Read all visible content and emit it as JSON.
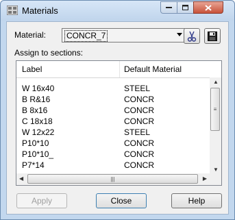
{
  "window": {
    "title": "Materials",
    "controls": {
      "minimize": "–",
      "maximize": "□",
      "close": "✕"
    }
  },
  "material": {
    "label": "Material:",
    "selected": "CONCR_7",
    "cut_icon": "scissors-icon",
    "save_icon": "floppy-disk-icon"
  },
  "assign": {
    "label": "Assign to sections:",
    "columns": [
      "Label",
      "Default Material"
    ],
    "rows": [
      [
        "W 16x40",
        "STEEL"
      ],
      [
        "B R&16",
        "CONCR"
      ],
      [
        "B 8x16",
        "CONCR"
      ],
      [
        "C 18x18",
        "CONCR"
      ],
      [
        "W 12x22",
        "STEEL"
      ],
      [
        "P10*10",
        "CONCR"
      ],
      [
        "P10*10_",
        "CONCR"
      ],
      [
        "P7*14",
        "CONCR"
      ]
    ]
  },
  "buttons": {
    "apply": "Apply",
    "close": "Close",
    "help": "Help"
  },
  "colors": {
    "title_bar": "#c8daf0",
    "close_button": "#c8523a",
    "panel": "#f0f0f0"
  }
}
